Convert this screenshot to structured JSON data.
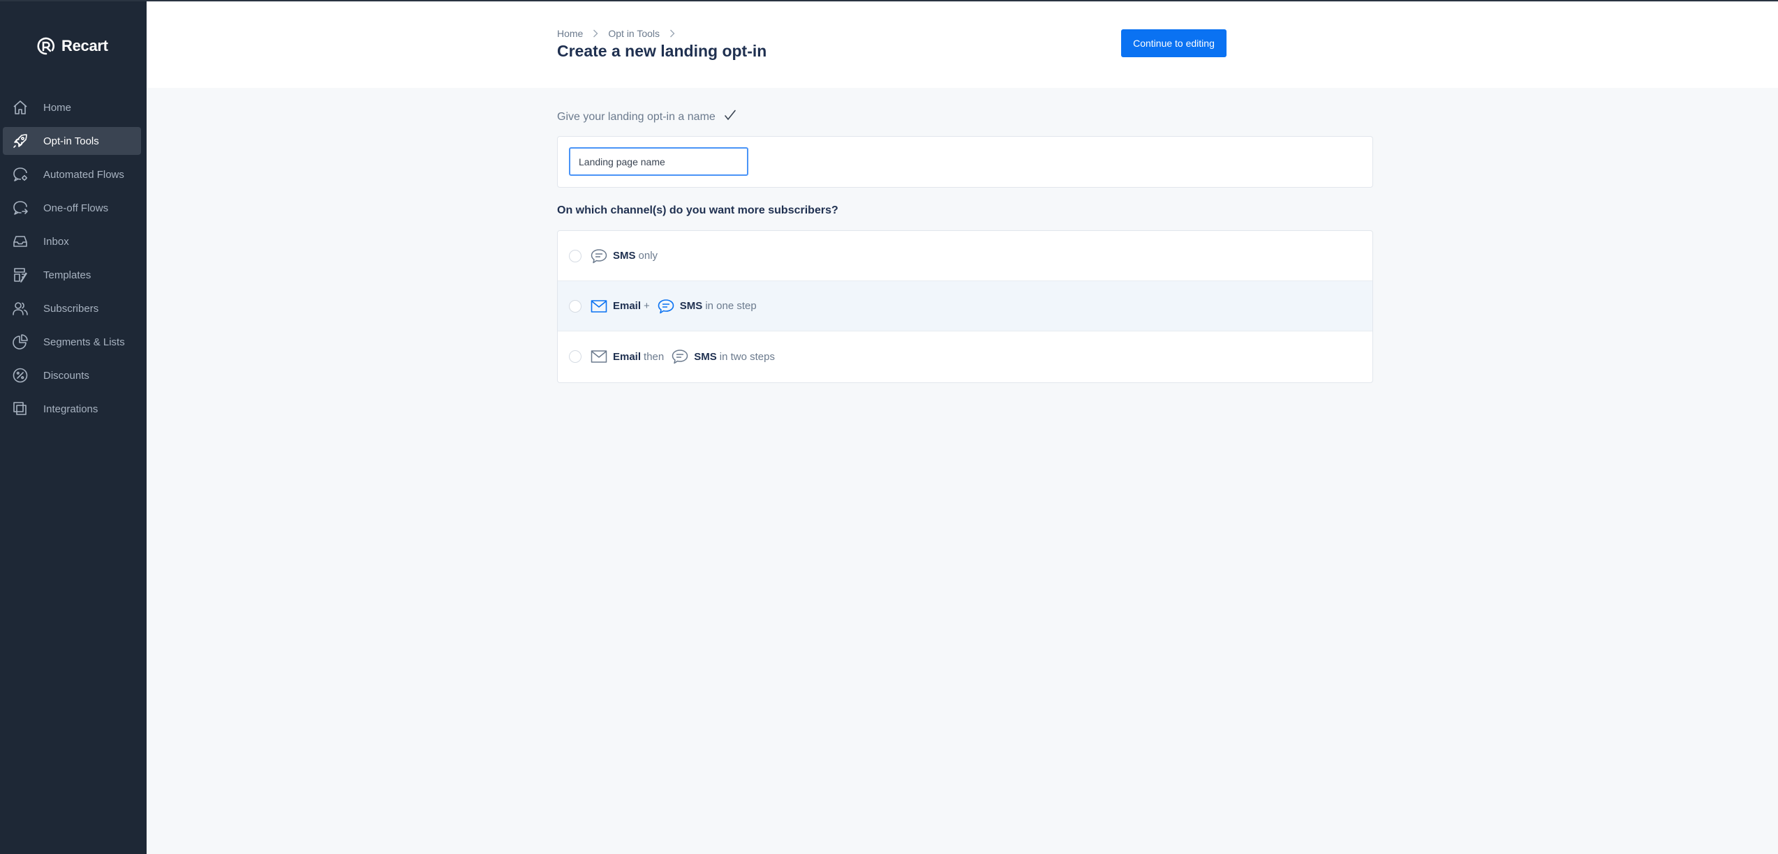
{
  "app": {
    "brand": "Recart"
  },
  "sidebar": {
    "items": [
      {
        "label": "Home",
        "icon": "home-icon"
      },
      {
        "label": "Opt-in Tools",
        "icon": "rocket-icon",
        "active": true
      },
      {
        "label": "Automated Flows",
        "icon": "chat-gear-icon"
      },
      {
        "label": "One-off Flows",
        "icon": "chat-arrow-icon"
      },
      {
        "label": "Inbox",
        "icon": "inbox-icon"
      },
      {
        "label": "Templates",
        "icon": "templates-icon"
      },
      {
        "label": "Subscribers",
        "icon": "users-icon"
      },
      {
        "label": "Segments & Lists",
        "icon": "pie-chart-icon"
      },
      {
        "label": "Discounts",
        "icon": "percent-icon"
      },
      {
        "label": "Integrations",
        "icon": "integrations-icon"
      }
    ]
  },
  "header": {
    "breadcrumb": [
      "Home",
      "Opt in Tools"
    ],
    "title": "Create a new landing opt-in",
    "primary_button": "Continue to editing"
  },
  "name_section": {
    "label": "Give your landing opt-in a name",
    "input_value": "",
    "input_placeholder": "Landing page name"
  },
  "channels": {
    "question": "On which channel(s) do you want more subscribers?",
    "options": [
      {
        "parts": [
          "SMS",
          "only"
        ],
        "icons": [
          "sms-icon"
        ]
      },
      {
        "parts": [
          "Email",
          "+",
          "SMS",
          "in one step"
        ],
        "icons": [
          "email-icon",
          "sms-icon"
        ]
      },
      {
        "parts": [
          "Email",
          "then",
          "SMS",
          "in two steps"
        ],
        "icons": [
          "email-icon",
          "sms-icon"
        ]
      }
    ]
  },
  "colors": {
    "sidebar_bg": "#1e2836",
    "sidebar_active": "#3a4452",
    "accent": "#0a72f2",
    "page_bg": "#f6f8fa",
    "title": "#1f3050"
  }
}
